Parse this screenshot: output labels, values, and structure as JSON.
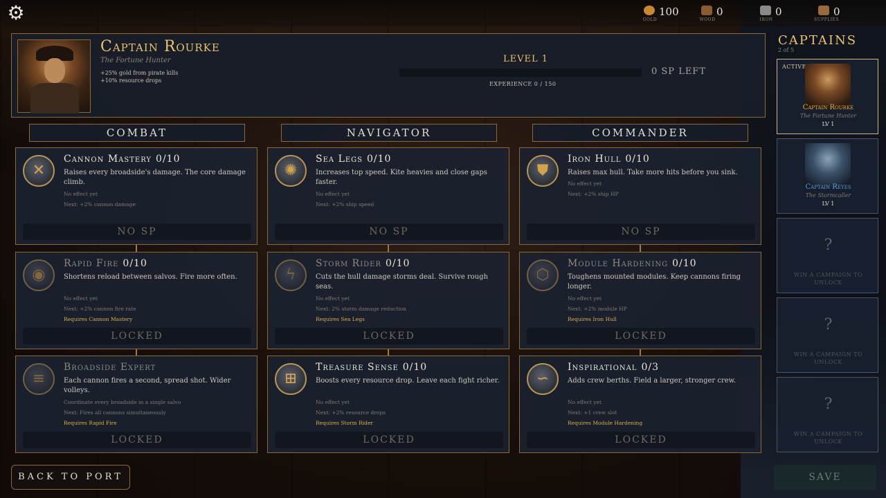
{
  "resources": [
    {
      "name": "gold-resource",
      "label": "Gold",
      "value": "100",
      "color": "#c9872e"
    },
    {
      "name": "wood-resource",
      "label": "Wood",
      "value": "0",
      "color": "#8a5a30"
    },
    {
      "name": "iron-resource",
      "label": "Iron",
      "value": "0",
      "color": "#8a8a8a"
    },
    {
      "name": "supplies-resource",
      "label": "Supplies",
      "value": "0",
      "color": "#9a6a3a"
    }
  ],
  "hero": {
    "name": "Captain Rourke",
    "title": "The Fortune Hunter",
    "bonuses": [
      "+25% gold from pirate kills",
      "+10% resource drops"
    ],
    "level": "LEVEL 1",
    "xp_text": "EXPERIENCE 0 / 150",
    "xp_fraction": 0,
    "sp_text": "0 SP LEFT"
  },
  "columns": [
    "COMBAT",
    "NAVIGATOR",
    "COMMANDER"
  ],
  "skills": [
    {
      "name": "Cannon Mastery",
      "count": "0/10",
      "desc": "Raises every broadside's damage. The core damage climb.",
      "effect": "No effect yet",
      "next": "Next: +2% cannon damage",
      "req": "",
      "footer": "NO SP",
      "icon": "crossed-cannons-icon",
      "glyph": "✕",
      "locked": false
    },
    {
      "name": "Sea Legs",
      "count": "0/10",
      "desc": "Increases top speed. Kite heavies and close gaps faster.",
      "effect": "No effect yet",
      "next": "Next: +2% ship speed",
      "req": "",
      "footer": "NO SP",
      "icon": "compass-icon",
      "glyph": "✺",
      "locked": false
    },
    {
      "name": "Iron Hull",
      "count": "0/10",
      "desc": "Raises max hull. Take more hits before you sink.",
      "effect": "No effect yet",
      "next": "Next: +2% ship HP",
      "req": "",
      "footer": "NO SP",
      "icon": "shield-icon",
      "glyph": "⛊",
      "locked": false
    },
    {
      "name": "Rapid Fire",
      "count": "0/10",
      "desc": "Shortens reload between salvos. Fire more often.",
      "effect": "No effect yet",
      "next": "Next: +2% cannon fire rate",
      "req": "Requires Cannon Mastery",
      "footer": "LOCKED",
      "icon": "fire-ring-icon",
      "glyph": "◉",
      "locked": true
    },
    {
      "name": "Storm Rider",
      "count": "0/10",
      "desc": "Cuts the hull damage storms deal. Survive rough seas.",
      "effect": "No effect yet",
      "next": "Next: 2% storm damage reduction",
      "req": "Requires Sea Legs",
      "footer": "LOCKED",
      "icon": "lightning-storm-icon",
      "glyph": "ϟ",
      "locked": true
    },
    {
      "name": "Module Hardening",
      "count": "0/10",
      "desc": "Toughens mounted modules. Keep cannons firing longer.",
      "effect": "No effect yet",
      "next": "Next: +2% module HP",
      "req": "Requires Iron Hull",
      "footer": "LOCKED",
      "icon": "riveted-plate-icon",
      "glyph": "⬡",
      "locked": true
    },
    {
      "name": "Broadside Expert",
      "count": "",
      "desc": "Each cannon fires a second, spread shot. Wider volleys.",
      "effect": "Coordinate every broadside in a single salvo",
      "next": "Next: Fires all cannons simultaneously",
      "req": "Requires Rapid Fire",
      "footer": "LOCKED",
      "icon": "cannon-volley-icon",
      "glyph": "≡",
      "locked": true
    },
    {
      "name": "Treasure Sense",
      "count": "0/10",
      "desc": "Boosts every resource drop. Leave each fight richer.",
      "effect": "No effect yet",
      "next": "Next: +2% resource drops",
      "req": "Requires Storm Rider",
      "footer": "LOCKED",
      "icon": "treasure-chest-icon",
      "glyph": "⊞",
      "locked": false
    },
    {
      "name": "Inspirational",
      "count": "0/3",
      "desc": "Adds crew berths. Field a larger, stronger crew.",
      "effect": "No effect yet",
      "next": "Next: +1 crew slot",
      "req": "Requires Module Hardening",
      "footer": "LOCKED",
      "icon": "horn-icon",
      "glyph": "∽",
      "locked": false
    }
  ],
  "captains_panel": {
    "title": "CAPTAINS",
    "count": "2 of 5",
    "cards": [
      {
        "status": "ACTIVE",
        "name": "Captain Rourke",
        "title": "The Fortune Hunter",
        "level": "LV 1"
      },
      {
        "status": "",
        "name": "Captain Reyes",
        "title": "The Stormcaller",
        "level": "LV 1"
      }
    ],
    "locked_card": {
      "mark": "?",
      "text": "WIN A CAMPAIGN TO UNLOCK"
    }
  },
  "buttons": {
    "back": "BACK TO PORT",
    "save": "SAVE"
  }
}
